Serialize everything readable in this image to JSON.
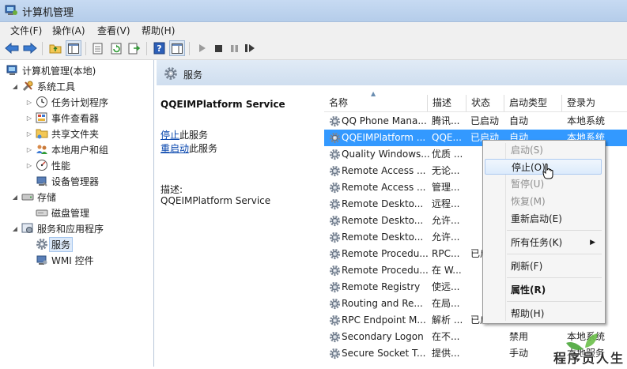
{
  "window": {
    "title": "计算机管理"
  },
  "menu": [
    "文件(F)",
    "操作(A)",
    "查看(V)",
    "帮助(H)"
  ],
  "tree": [
    {
      "label": "计算机管理(本地)",
      "icon": "computer-icon",
      "expander": "",
      "level": 0
    },
    {
      "label": "系统工具",
      "icon": "tools-icon",
      "expander": "◢",
      "level": 1
    },
    {
      "label": "任务计划程序",
      "icon": "clock-icon",
      "expander": "▷",
      "level": 2
    },
    {
      "label": "事件查看器",
      "icon": "event-viewer-icon",
      "expander": "▷",
      "level": 2
    },
    {
      "label": "共享文件夹",
      "icon": "shared-folder-icon",
      "expander": "▷",
      "level": 2
    },
    {
      "label": "本地用户和组",
      "icon": "users-icon",
      "expander": "▷",
      "level": 2
    },
    {
      "label": "性能",
      "icon": "performance-icon",
      "expander": "▷",
      "level": 2
    },
    {
      "label": "设备管理器",
      "icon": "device-manager-icon",
      "expander": "",
      "level": 2
    },
    {
      "label": "存储",
      "icon": "storage-icon",
      "expander": "◢",
      "level": 1
    },
    {
      "label": "磁盘管理",
      "icon": "disk-icon",
      "expander": "",
      "level": 2
    },
    {
      "label": "服务和应用程序",
      "icon": "services-apps-icon",
      "expander": "◢",
      "level": 1
    },
    {
      "label": "服务",
      "icon": "gear-icon",
      "expander": "",
      "level": 2,
      "selected": true
    },
    {
      "label": "WMI 控件",
      "icon": "wmi-icon",
      "expander": "",
      "level": 2
    }
  ],
  "services_header": {
    "title": "服务"
  },
  "detail": {
    "service_name": "QQEIMPlatform Service",
    "stop_link": "停止",
    "stop_suffix": "此服务",
    "restart_link": "重启动",
    "restart_suffix": "此服务",
    "desc_label": "描述:",
    "desc_value": "QQEIMPlatform Service"
  },
  "columns": [
    "名称",
    "描述",
    "状态",
    "启动类型",
    "登录为"
  ],
  "rows": [
    {
      "name": "QQ Phone Mana...",
      "desc": "腾讯...",
      "status": "已启动",
      "startup": "自动",
      "logon": "本地系统"
    },
    {
      "name": "QQEIMPlatform ...",
      "desc": "QQE...",
      "status": "已启动",
      "startup": "自动",
      "logon": "本地系统",
      "selected": true
    },
    {
      "name": "Quality Windows...",
      "desc": "优质 ...",
      "status": "",
      "startup": "",
      "logon": ""
    },
    {
      "name": "Remote Access ...",
      "desc": "无论...",
      "status": "",
      "startup": "",
      "logon": ""
    },
    {
      "name": "Remote Access ...",
      "desc": "管理...",
      "status": "",
      "startup": "",
      "logon": ""
    },
    {
      "name": "Remote Deskto...",
      "desc": "远程...",
      "status": "",
      "startup": "",
      "logon": ""
    },
    {
      "name": "Remote Deskto...",
      "desc": "允许...",
      "status": "",
      "startup": "",
      "logon": ""
    },
    {
      "name": "Remote Deskto...",
      "desc": "允许...",
      "status": "",
      "startup": "",
      "logon": ""
    },
    {
      "name": "Remote Procedu...",
      "desc": "RPC...",
      "status": "已启",
      "startup": "",
      "logon": ""
    },
    {
      "name": "Remote Procedu...",
      "desc": "在 W...",
      "status": "",
      "startup": "",
      "logon": ""
    },
    {
      "name": "Remote Registry",
      "desc": "使远...",
      "status": "",
      "startup": "",
      "logon": ""
    },
    {
      "name": "Routing and Re...",
      "desc": "在局...",
      "status": "",
      "startup": "",
      "logon": ""
    },
    {
      "name": "RPC Endpoint M...",
      "desc": "解析 ...",
      "status": "已启",
      "startup": "",
      "logon": ""
    },
    {
      "name": "Secondary Logon",
      "desc": "在不...",
      "status": "",
      "startup": "禁用",
      "logon": "本地系统"
    },
    {
      "name": "Secure Socket T...",
      "desc": "提供...",
      "status": "",
      "startup": "手动",
      "logon": "本地服务"
    }
  ],
  "context_menu": [
    {
      "label": "启动(S)",
      "disabled": true
    },
    {
      "label": "停止(O)",
      "hover": true
    },
    {
      "label": "暂停(U)",
      "disabled": true
    },
    {
      "label": "恢复(M)",
      "disabled": true
    },
    {
      "label": "重新启动(E)"
    },
    {
      "separator": true
    },
    {
      "label": "所有任务(K)",
      "submenu": true
    },
    {
      "separator": true
    },
    {
      "label": "刷新(F)"
    },
    {
      "separator": true
    },
    {
      "label": "属性(R)",
      "bold": true
    },
    {
      "separator": true
    },
    {
      "label": "帮助(H)"
    }
  ],
  "watermark": {
    "text": "程序员人生"
  },
  "colors": {
    "selection": "#3399ff",
    "link": "#0645ad",
    "title_bar": "#c7daf2"
  }
}
